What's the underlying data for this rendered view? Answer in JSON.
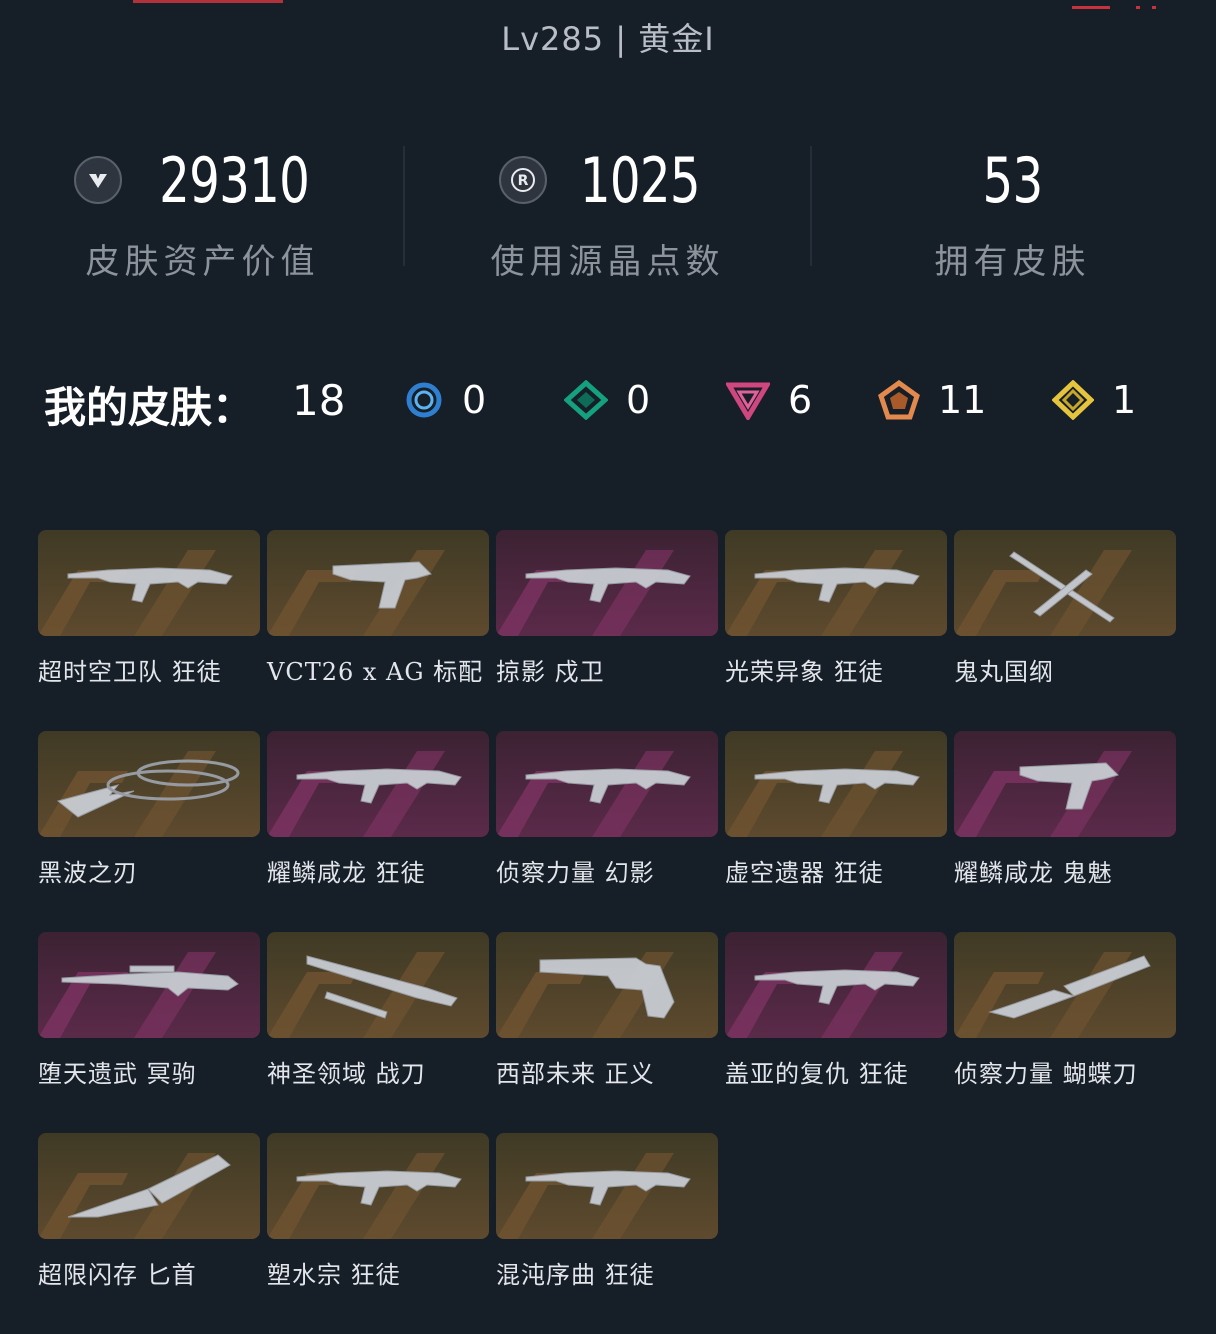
{
  "header": {
    "level_rank": "Lv285 | 黄金I"
  },
  "stats": [
    {
      "value": "29310",
      "label": "皮肤资产价值",
      "icon": "valorant-points-icon"
    },
    {
      "value": "1025",
      "label": "使用源晶点数",
      "icon": "radianite-points-icon"
    },
    {
      "value": "53",
      "label": "拥有皮肤",
      "icon": ""
    }
  ],
  "summary": {
    "title": "我的皮肤：",
    "total": "18",
    "tiers": [
      {
        "icon": "select-tier-icon",
        "color": "#3a8fd8",
        "count": "0"
      },
      {
        "icon": "deluxe-tier-icon",
        "color": "#1fae8c",
        "count": "0"
      },
      {
        "icon": "premium-tier-icon",
        "color": "#d04a86",
        "count": "6"
      },
      {
        "icon": "exclusive-tier-icon",
        "color": "#e8915a",
        "count": "11"
      },
      {
        "icon": "ultra-tier-icon",
        "color": "#e8c94a",
        "count": "1"
      }
    ]
  },
  "skins": [
    {
      "name": "超时空卫队 狂徒",
      "tier": "gold",
      "weapon": "rifle"
    },
    {
      "name": "VCT26 x AG 标配",
      "tier": "gold",
      "weapon": "pistol"
    },
    {
      "name": "掠影 戍卫",
      "tier": "purple",
      "weapon": "rifle"
    },
    {
      "name": "光荣异象 狂徒",
      "tier": "gold",
      "weapon": "rifle"
    },
    {
      "name": "鬼丸国纲",
      "tier": "gold",
      "weapon": "katana"
    },
    {
      "name": "黑波之刃",
      "tier": "gold",
      "weapon": "kunai"
    },
    {
      "name": "耀鳞咸龙 狂徒",
      "tier": "purple",
      "weapon": "rifle"
    },
    {
      "name": "侦察力量 幻影",
      "tier": "purple",
      "weapon": "rifle"
    },
    {
      "name": "虚空遗器 狂徒",
      "tier": "gold",
      "weapon": "rifle"
    },
    {
      "name": "耀鳞咸龙 鬼魅",
      "tier": "purple",
      "weapon": "pistol"
    },
    {
      "name": "堕天遗武 冥驹",
      "tier": "purple",
      "weapon": "sniper"
    },
    {
      "name": "神圣领域 战刀",
      "tier": "gold",
      "weapon": "blade"
    },
    {
      "name": "西部未来 正义",
      "tier": "gold",
      "weapon": "revolver"
    },
    {
      "name": "盖亚的复仇 狂徒",
      "tier": "purple",
      "weapon": "rifle"
    },
    {
      "name": "侦察力量 蝴蝶刀",
      "tier": "gold",
      "weapon": "knife"
    },
    {
      "name": "超限闪存 匕首",
      "tier": "gold",
      "weapon": "dagger"
    },
    {
      "name": "塑水宗 狂徒",
      "tier": "gold",
      "weapon": "rifle"
    },
    {
      "name": "混沌序曲 狂徒",
      "tier": "gold",
      "weapon": "rifle"
    }
  ]
}
